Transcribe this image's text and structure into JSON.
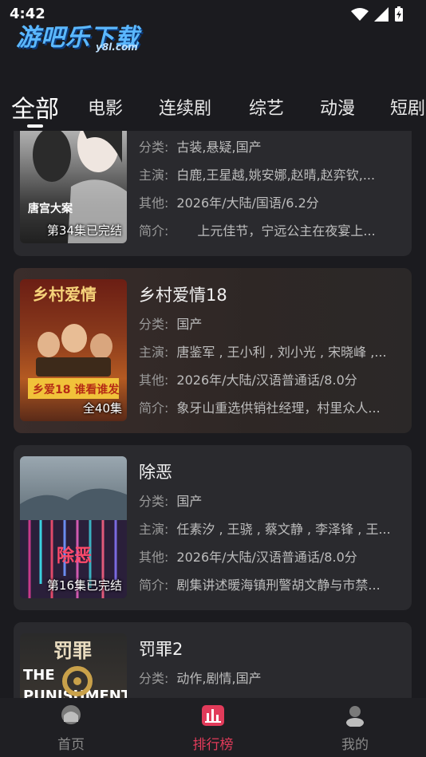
{
  "status": {
    "time": "4:42"
  },
  "app": {
    "logo_text": "游吧乐下载",
    "logo_sub": "y8l.com"
  },
  "tabs": [
    {
      "label": "全部",
      "active": true
    },
    {
      "label": "电影"
    },
    {
      "label": "连续剧"
    },
    {
      "label": "综艺"
    },
    {
      "label": "动漫"
    },
    {
      "label": "短剧"
    }
  ],
  "labels": {
    "category": "分类:",
    "cast": "主演:",
    "other": "其他:",
    "intro": "简介:"
  },
  "items": [
    {
      "title": "",
      "badge": "第34集已完结",
      "category": "古装,悬疑,国产",
      "cast": "白鹿,王星越,姚安娜,赵晴,赵弈钦,...",
      "other": "2026年/大陆/国语/6.2分",
      "intro": "上元佳节，宁远公主在夜宴上...",
      "intro_indent": true
    },
    {
      "title": "乡村爱情18",
      "badge": "全40集",
      "category": "国产",
      "cast": "唐鉴军 , 王小利 , 刘小光 , 宋晓峰 ,...",
      "other": "2026年/大陆/汉语普通话/8.0分",
      "intro": "象牙山重选供销社经理，村里众人..."
    },
    {
      "title": "除恶",
      "badge": "第16集已完结",
      "category": "国产",
      "cast": "任素汐 , 王骁 , 蔡文静 , 李泽锋 , 王...",
      "other": "2026年/大陆/汉语普通话/8.0分",
      "intro": "剧集讲述暖海镇刑警胡文静与市禁..."
    },
    {
      "title": "罚罪2",
      "badge": "",
      "category": "动作,剧情,国产",
      "cast": "",
      "other": "",
      "intro": ""
    }
  ],
  "bottom_nav": [
    {
      "label": "首页",
      "icon": "home-icon"
    },
    {
      "label": "排行榜",
      "icon": "ranking-icon",
      "active": true
    },
    {
      "label": "我的",
      "icon": "profile-icon"
    }
  ],
  "colors": {
    "accent": "#e23b5a",
    "background": "#1b1b1f",
    "card": "#2a2a2e",
    "logo": "#5bb8ff"
  }
}
